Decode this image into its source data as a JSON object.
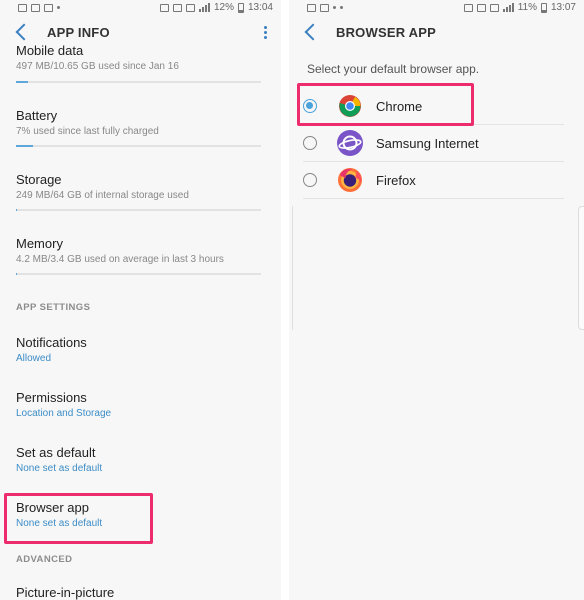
{
  "left": {
    "status": {
      "battery_pct": "12%",
      "time": "13:04"
    },
    "title": "APP INFO",
    "items": [
      {
        "title": "Mobile data",
        "subtitle": "497 MB/10.65 GB used since Jan 16"
      },
      {
        "title": "Battery",
        "subtitle": "7% used since last fully charged"
      },
      {
        "title": "Storage",
        "subtitle": "249 MB/64 GB of internal storage used"
      },
      {
        "title": "Memory",
        "subtitle": "4.2 MB/3.4 GB used on average in last 3 hours"
      }
    ],
    "meters": {
      "mobile_data": 0.05,
      "battery": 0.07,
      "storage": 0.004,
      "memory": 0.001
    },
    "app_settings_header": "APP SETTINGS",
    "settings": [
      {
        "title": "Notifications",
        "subtitle": "Allowed"
      },
      {
        "title": "Permissions",
        "subtitle": "Location and Storage"
      },
      {
        "title": "Set as default",
        "subtitle": "None set as default"
      },
      {
        "title": "Browser app",
        "subtitle": "None set as default"
      }
    ],
    "advanced_header": "ADVANCED",
    "last_item": "Picture-in-picture"
  },
  "right": {
    "status": {
      "battery_pct": "11%",
      "time": "13:07"
    },
    "title": "BROWSER APP",
    "intro": "Select your default browser app.",
    "options": [
      {
        "label": "Chrome",
        "icon": "chrome-icon",
        "selected": true
      },
      {
        "label": "Samsung Internet",
        "icon": "samsung-internet-icon",
        "selected": false
      },
      {
        "label": "Firefox",
        "icon": "firefox-icon",
        "selected": false
      }
    ]
  },
  "colors": {
    "accent": "#3a7fc1",
    "highlight": "#ed2c6e",
    "radio": "#4aa2dc"
  }
}
